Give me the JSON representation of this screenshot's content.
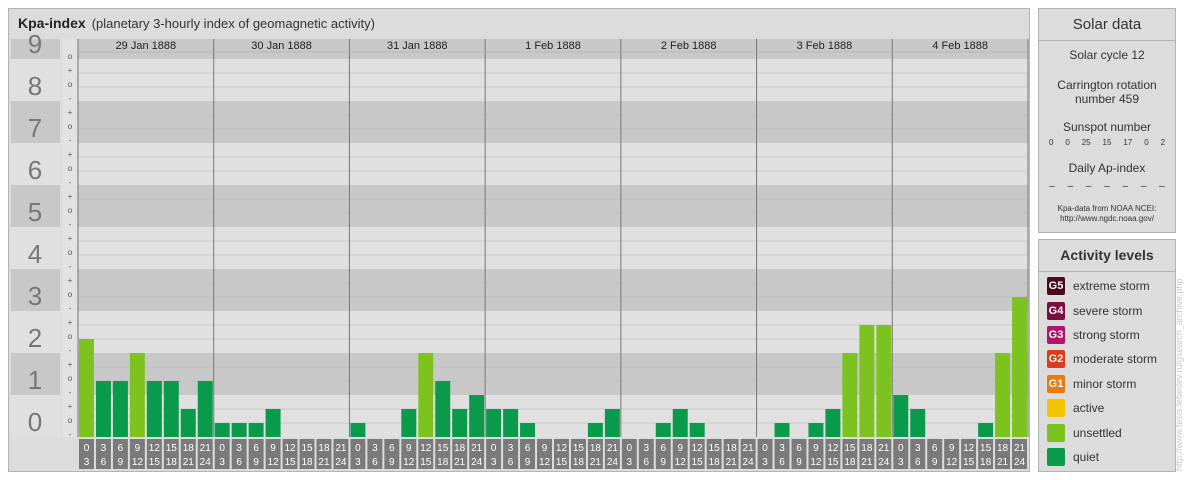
{
  "header": {
    "title": "Kpa-index",
    "subtitle": "(planetary 3-hourly index of geomagnetic activity)"
  },
  "chart_data": {
    "type": "bar",
    "title": "Kpa-index",
    "subtitle": "(planetary 3-hourly index of geomagnetic activity)",
    "ylim": [
      0,
      9
    ],
    "y_ticks": [
      "0",
      "1",
      "2",
      "3",
      "4",
      "5",
      "6",
      "7",
      "8",
      "9"
    ],
    "y_minor_ticks": [
      "-",
      "o",
      "+"
    ],
    "days": [
      "29 Jan 1888",
      "30 Jan 1888",
      "31 Jan 1888",
      "1 Feb 1888",
      "2 Feb 1888",
      "3 Feb 1888",
      "4 Feb 1888"
    ],
    "interval_start_labels": [
      "0",
      "3",
      "6",
      "9",
      "12",
      "15",
      "18",
      "21"
    ],
    "interval_end_labels": [
      "3",
      "6",
      "9",
      "12",
      "15",
      "18",
      "21",
      "24"
    ],
    "values": [
      2.333,
      1.333,
      1.333,
      2.0,
      1.333,
      1.333,
      0.667,
      1.333,
      0.333,
      0.333,
      0.333,
      0.667,
      0,
      0,
      0,
      0,
      0.333,
      0,
      0,
      0.667,
      2.0,
      1.333,
      0.667,
      1.0,
      0.667,
      0.667,
      0.333,
      0,
      0,
      0,
      0.333,
      0.667,
      0,
      0,
      0.333,
      0.667,
      0.333,
      0,
      0,
      0,
      0,
      0.333,
      0,
      0.333,
      0.667,
      2.0,
      2.667,
      2.667,
      1.0,
      0.667,
      0,
      0,
      0,
      0.333,
      2.0,
      3.333
    ],
    "level_colors": {
      "quiet": "#0a9a4c",
      "unsettled": "#7cc31f"
    },
    "colors": {
      "background": "#dcdcdc",
      "band_dark": "#c8c8c8",
      "band_light": "#e0e0e0",
      "label_box": "#7a7a7a"
    }
  },
  "solar": {
    "title": "Solar data",
    "cycle": "Solar cycle 12",
    "carrington_1": "Carrington rotation",
    "carrington_2": "number 459",
    "sunspot_label": "Sunspot number",
    "sunspot_values": [
      "0",
      "0",
      "25",
      "15",
      "17",
      "0",
      "2"
    ],
    "ap_label": "Daily Ap-index",
    "ap_values": [
      "–",
      "–",
      "–",
      "–",
      "–",
      "–",
      "–"
    ],
    "source_1": "Kpa-data from NOAA NCEI:",
    "source_2": "http://www.ngdc.noaa.gov/"
  },
  "levels": {
    "title": "Activity levels",
    "items": [
      {
        "code": "G5",
        "label": "extreme storm",
        "color": "#4a0a1e"
      },
      {
        "code": "G4",
        "label": "severe storm",
        "color": "#7a0f3f"
      },
      {
        "code": "G3",
        "label": "strong storm",
        "color": "#b0156a"
      },
      {
        "code": "G2",
        "label": "moderate storm",
        "color": "#dc3a1a"
      },
      {
        "code": "G1",
        "label": "minor storm",
        "color": "#e87a10"
      },
      {
        "code": "",
        "label": "active",
        "color": "#f5c400"
      },
      {
        "code": "",
        "label": "unsettled",
        "color": "#7cc31f"
      },
      {
        "code": "",
        "label": "quiet",
        "color": "#0a9a4c"
      }
    ]
  },
  "watermark": "http://www.tesis.lebedev.ru/gsearch_archive.php"
}
